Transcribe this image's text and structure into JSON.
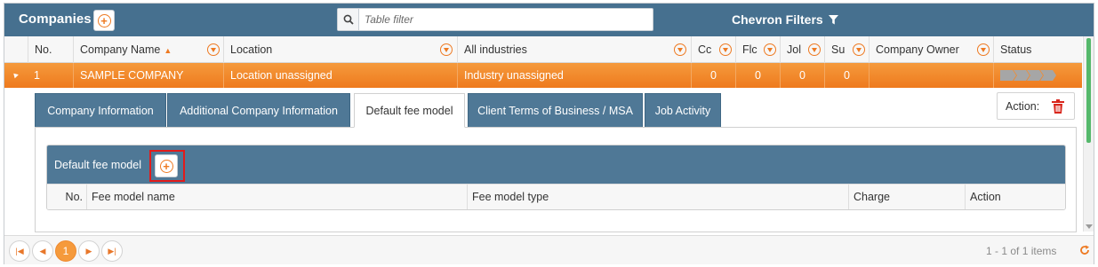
{
  "header": {
    "title": "Companies",
    "search_placeholder": "Table filter",
    "chevron_filters": "Chevron Filters"
  },
  "columns": [
    {
      "label": "No."
    },
    {
      "label": "Company Name"
    },
    {
      "label": "Location"
    },
    {
      "label": "All industries"
    },
    {
      "label": "Cc"
    },
    {
      "label": "Flc"
    },
    {
      "label": "Jol"
    },
    {
      "label": "Su"
    },
    {
      "label": "Company Owner"
    },
    {
      "label": "Status"
    }
  ],
  "row": {
    "no": "1",
    "company_name": "SAMPLE COMPANY",
    "location": "Location unassigned",
    "industry": "Industry unassigned",
    "c1": "0",
    "c2": "0",
    "c3": "0",
    "c4": "0",
    "owner": "",
    "status_steps": 4
  },
  "tabs": [
    {
      "label": "Company Information"
    },
    {
      "label": "Additional Company Information"
    },
    {
      "label": "Default fee model"
    },
    {
      "label": "Client Terms of Business / MSA"
    },
    {
      "label": "Job Activity"
    }
  ],
  "action_label": "Action:",
  "fee_panel": {
    "title": "Default fee model",
    "columns": [
      "No.",
      "Fee model name",
      "Fee model type",
      "Charge",
      "Action"
    ]
  },
  "pager": {
    "current_page": "1",
    "info": "1 - 1 of 1 items"
  },
  "colors": {
    "header_bg": "#46708f",
    "accent_orange": "#ee7a22",
    "tab_bg": "#4f7896",
    "highlight_red": "#e21b1b"
  }
}
